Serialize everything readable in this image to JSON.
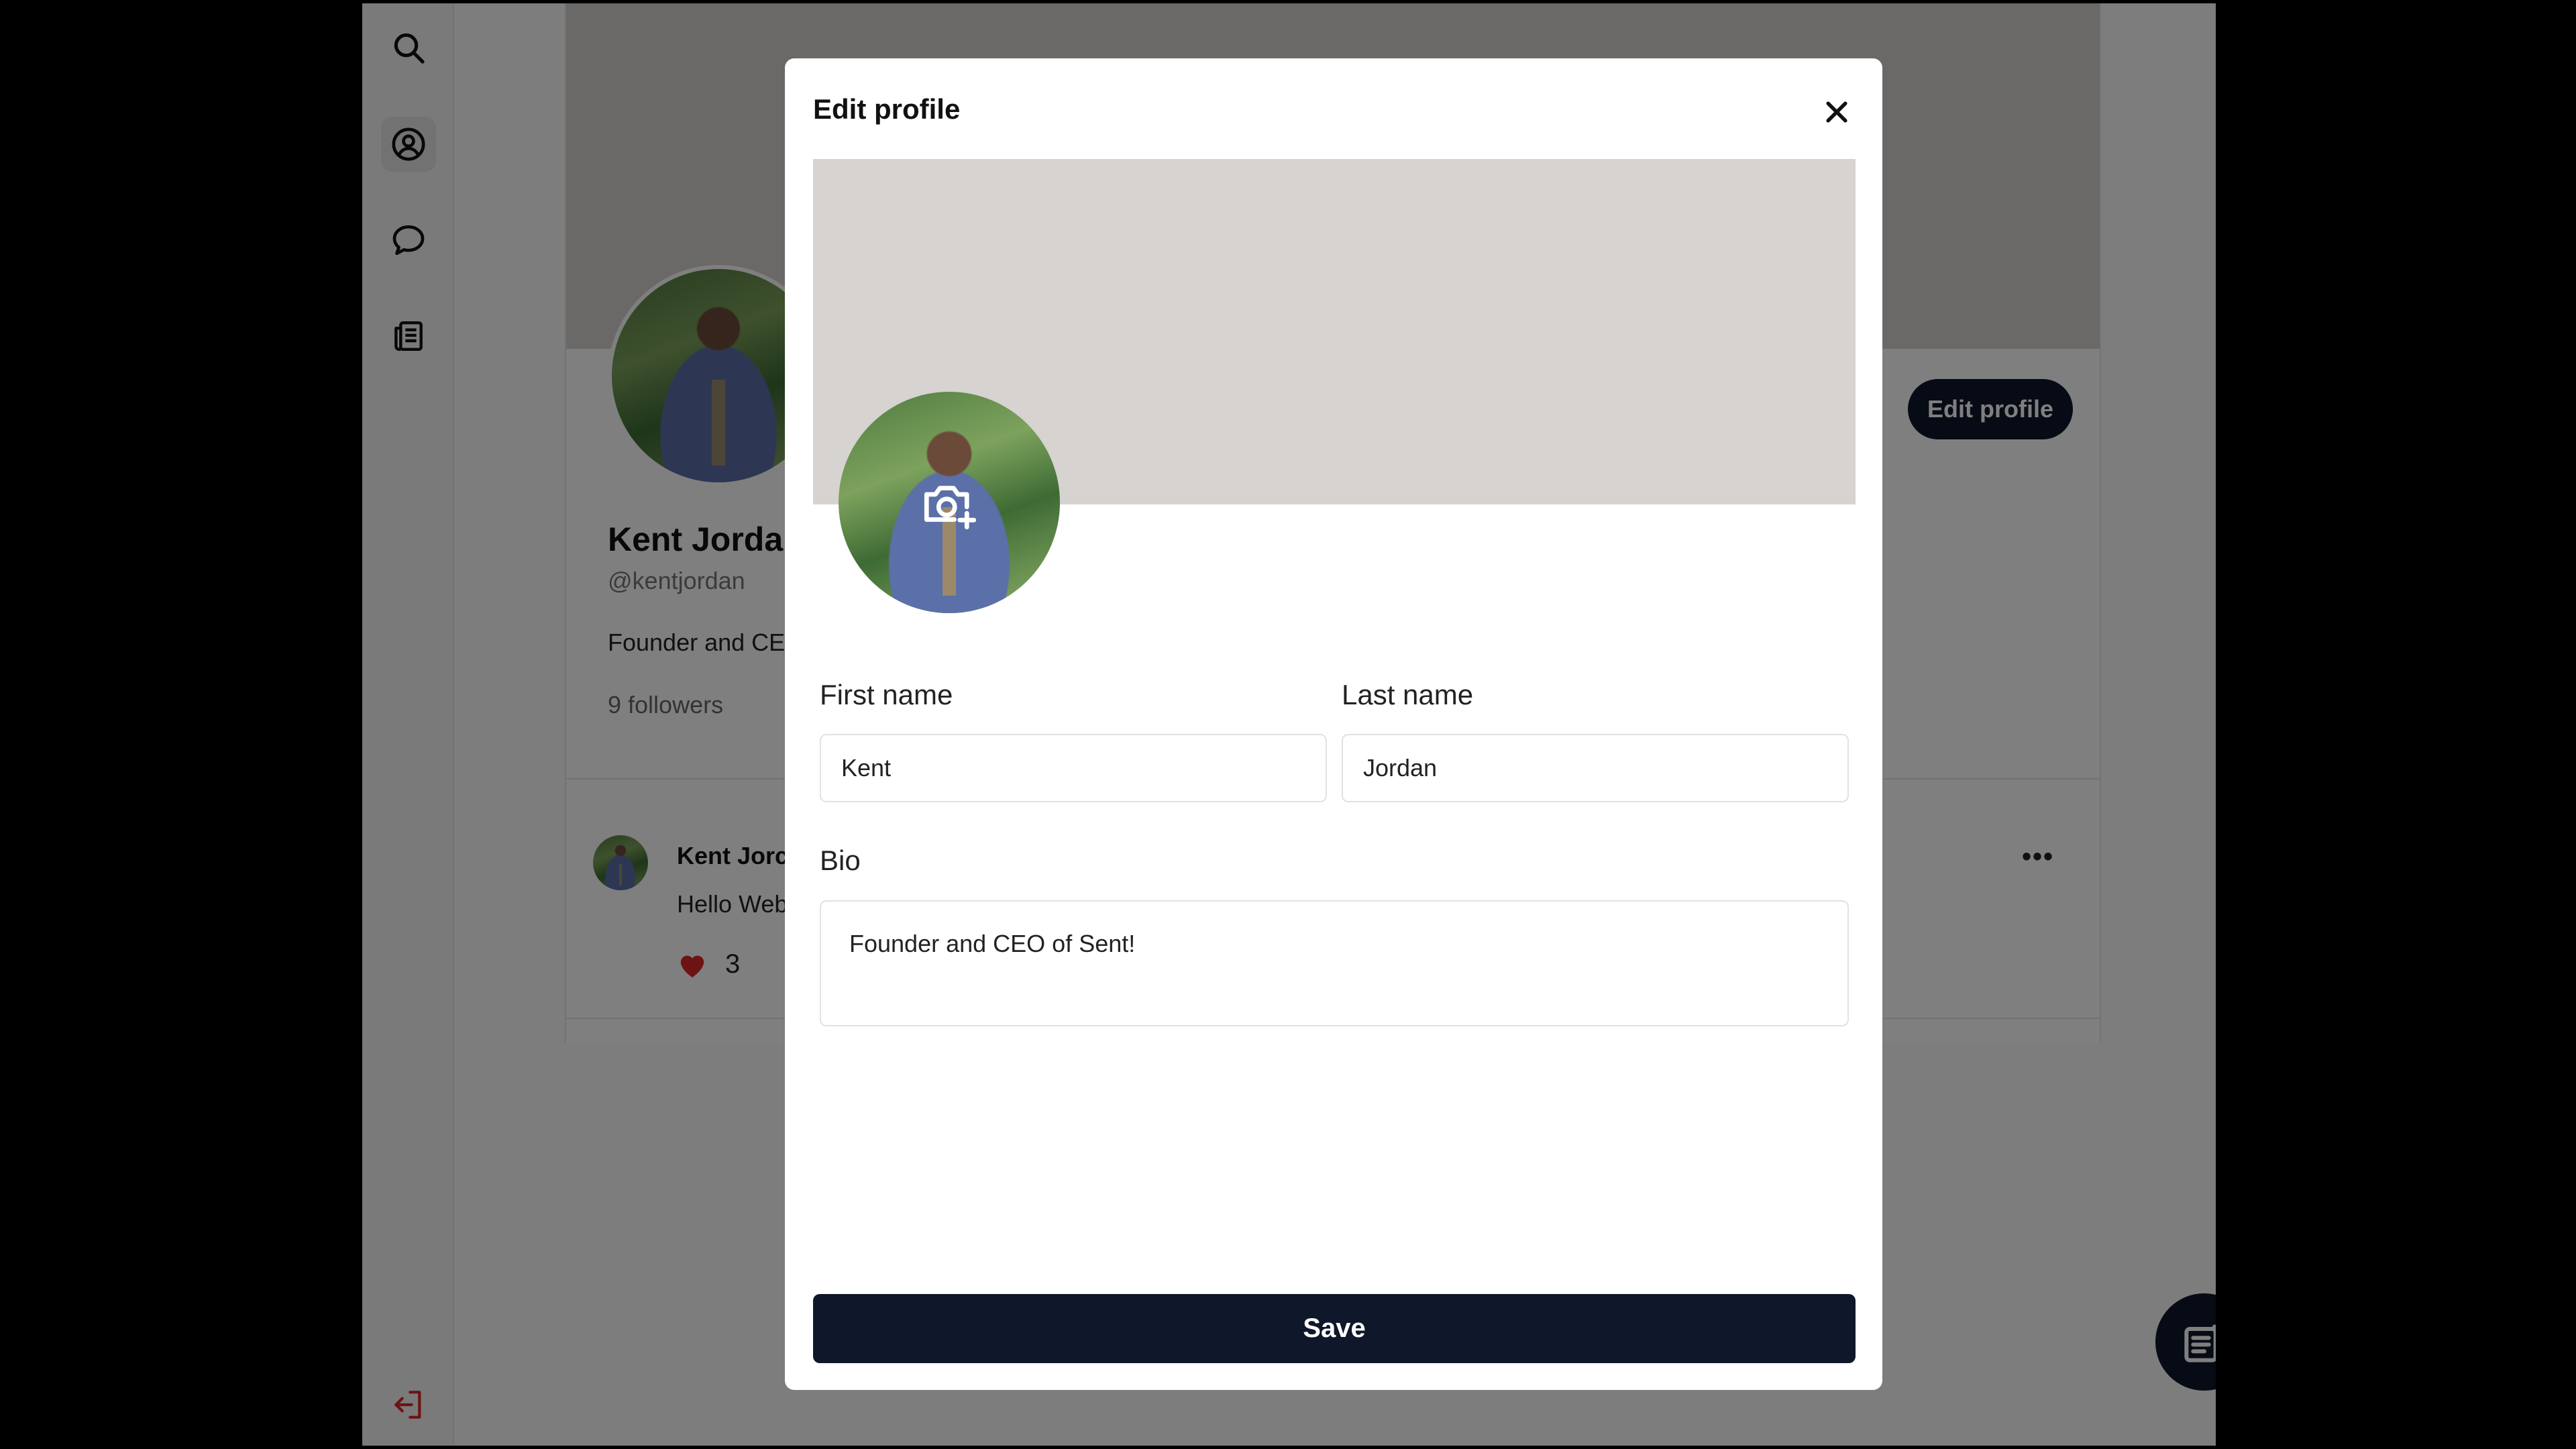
{
  "sidebar": {
    "icons": [
      "search-icon",
      "profile-icon",
      "chat-icon",
      "news-icon",
      "logout-icon"
    ],
    "active": "profile-icon"
  },
  "profile": {
    "name": "Kent Jorda",
    "handle": "@kentjordan",
    "bio": "Founder and CE",
    "followers": "9 followers",
    "edit_button": "Edit profile"
  },
  "post": {
    "author": "Kent Jorc",
    "text": "Hello Web",
    "likes": "3",
    "more": "•••"
  },
  "modal": {
    "title": "Edit profile",
    "first_name_label": "First name",
    "first_name_value": "Kent",
    "last_name_label": "Last name",
    "last_name_value": "Jordan",
    "bio_label": "Bio",
    "bio_value": "Founder and CEO of Sent!",
    "save_label": "Save"
  },
  "colors": {
    "primary": "#0f172a",
    "banner": "#d6d3d1",
    "like": "#dc2626"
  }
}
